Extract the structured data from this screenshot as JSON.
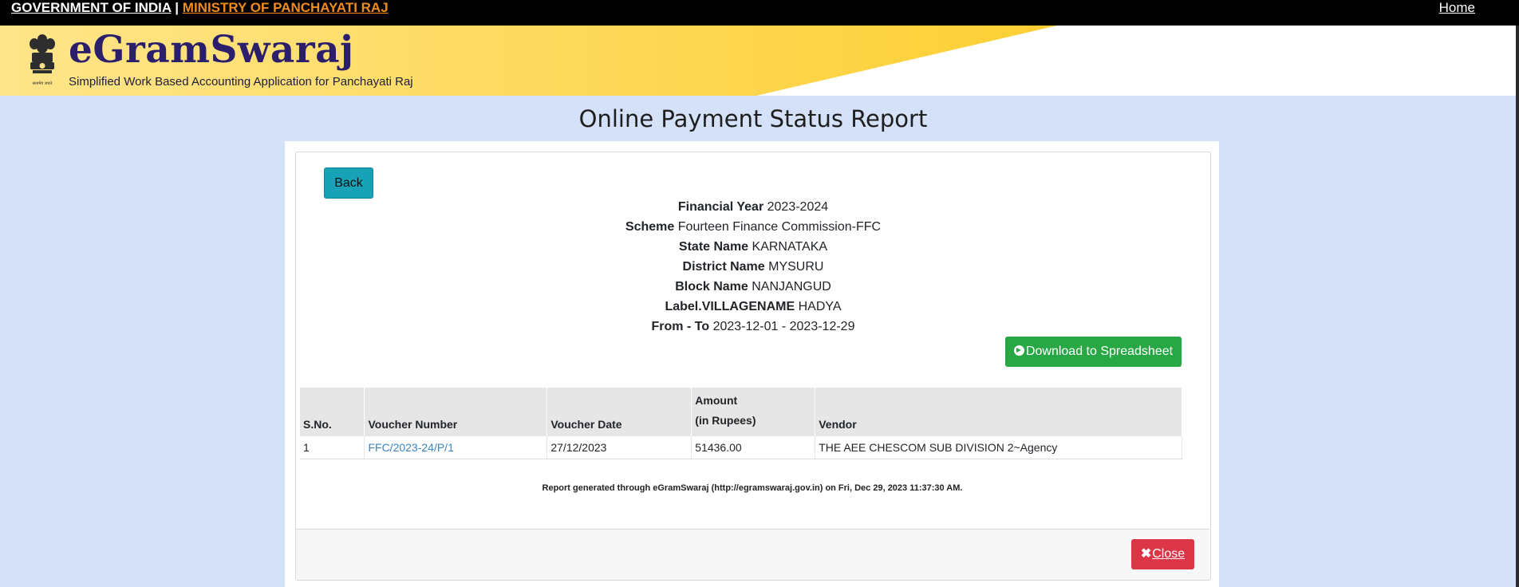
{
  "topbar": {
    "gov_label": "GOVERNMENT OF INDIA",
    "separator": "|",
    "ministry_label": "MINISTRY OF PANCHAYATI RAJ",
    "home_label": "Home"
  },
  "header": {
    "title": "eGramSwaraj",
    "subtitle": "Simplified Work Based Accounting Application for Panchayati Raj",
    "emblem_caption": "सत्यमेव जयते"
  },
  "page": {
    "title": "Online Payment Status Report",
    "back_label": "Back",
    "download_label": "Download to Spreadsheet",
    "close_label": "Close"
  },
  "report_info": [
    {
      "label": "Financial Year",
      "value": "2023-2024"
    },
    {
      "label": "Scheme",
      "value": "Fourteen Finance Commission-FFC"
    },
    {
      "label": "State Name",
      "value": "KARNATAKA"
    },
    {
      "label": "District Name",
      "value": "MYSURU"
    },
    {
      "label": "Block Name",
      "value": "NANJANGUD"
    },
    {
      "label": "Label.VILLAGENAME",
      "value": "HADYA"
    },
    {
      "label": "From - To",
      "value": "2023-12-01 - 2023-12-29"
    }
  ],
  "table": {
    "headers": {
      "sno": "S.No.",
      "voucher_number": "Voucher Number",
      "voucher_date": "Voucher Date",
      "amount_line1": "Amount",
      "amount_line2": "(in Rupees)",
      "vendor": "Vendor"
    },
    "rows": [
      {
        "sno": "1",
        "voucher_number": "FFC/2023-24/P/1",
        "voucher_date": "27/12/2023",
        "amount": "51436.00",
        "vendor": "THE AEE CHESCOM SUB DIVISION 2~Agency"
      }
    ]
  },
  "footer_note": "Report generated through eGramSwaraj (http://egramswaraj.gov.in) on Fri, Dec 29, 2023 11:37:30 AM.",
  "colors": {
    "page_bg": "#d5e1f8",
    "topbar_bg": "#000000",
    "ministry_link": "#f08c1c",
    "brand_title": "#2b1f6b",
    "back_button": "#17a2b8",
    "download_button": "#28a745",
    "close_button": "#dc3545",
    "link": "#3a86c8"
  },
  "icons": {
    "emblem": "national-emblem-icon",
    "download": "arrow-circle-right-icon",
    "close": "close-icon"
  }
}
